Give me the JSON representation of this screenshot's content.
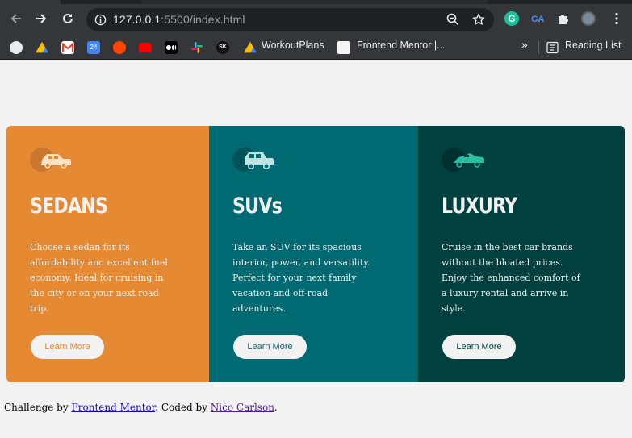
{
  "browser": {
    "url_host": "127.0.0.1",
    "url_rest": ":5500/index.html",
    "bookmarks": [
      {
        "icon": "globe-icon",
        "label": ""
      },
      {
        "icon": "google-drive-icon",
        "label": ""
      },
      {
        "icon": "gmail-icon",
        "label": ""
      },
      {
        "icon": "calendar-icon",
        "label": ""
      },
      {
        "icon": "reddit-icon",
        "label": ""
      },
      {
        "icon": "youtube-icon",
        "label": ""
      },
      {
        "icon": "medium-icon",
        "label": ""
      },
      {
        "icon": "slack-icon",
        "label": ""
      },
      {
        "icon": "sk-icon",
        "label": ""
      },
      {
        "icon": "google-drive-icon",
        "label": "WorkoutPlans"
      },
      {
        "icon": "frontend-mentor-icon",
        "label": "Frontend Mentor |..."
      }
    ],
    "more_bookmarks": "»",
    "reading_list": "Reading List",
    "colors": {
      "toolbar": "#35363a",
      "omnibox": "#202124"
    }
  },
  "cards": [
    {
      "title": "Sedans",
      "text": "Choose a sedan for its affordability and excellent fuel economy. Ideal for cruising in the city or on your next road trip.",
      "button": "Learn More",
      "icon": "sedan-car-icon",
      "color": "#e68933"
    },
    {
      "title": "SUVs",
      "text": "Take an SUV for its spacious interior, power, and versatility. Perfect for your next family vacation and off-road adventures.",
      "button": "Learn More",
      "icon": "suv-car-icon",
      "color": "#006971"
    },
    {
      "title": "Luxury",
      "text": "Cruise in the best car brands without the bloated prices. Enjoy the enhanced comfort of a luxury rental and arrive in style.",
      "button": "Learn More",
      "icon": "luxury-car-icon",
      "color": "#004140"
    }
  ],
  "attribution": {
    "prefix": "Challenge by ",
    "link1": "Frontend Mentor",
    "middle": ". Coded by ",
    "link2": "Nico Carlson",
    "suffix": "."
  }
}
